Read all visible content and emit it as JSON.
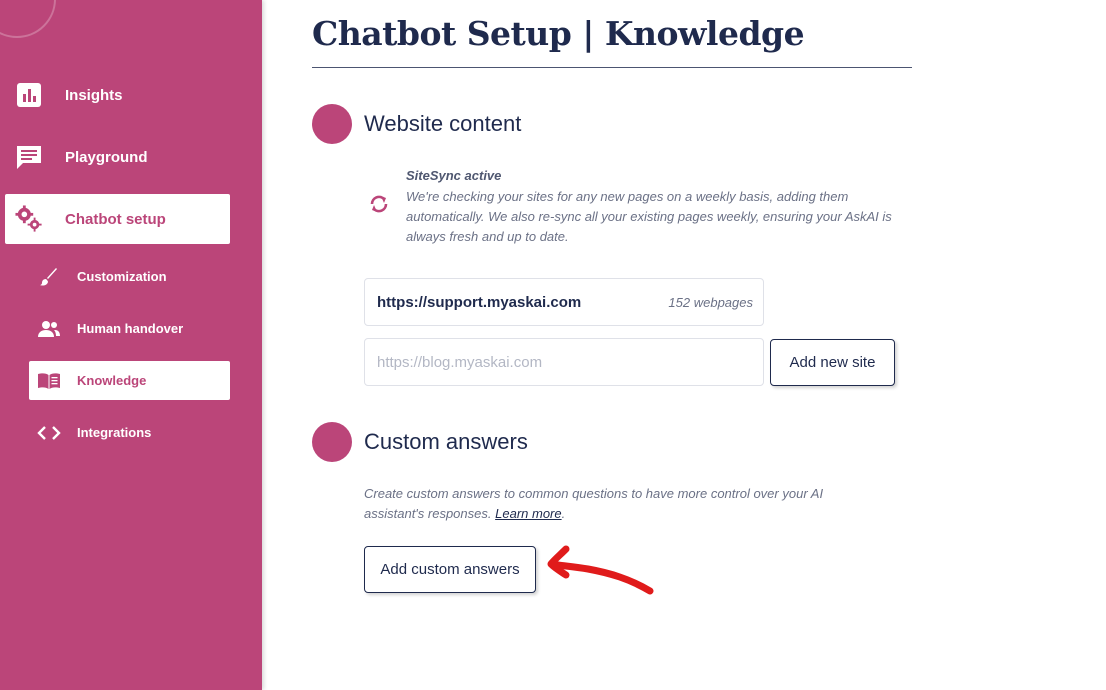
{
  "sidebar": {
    "items": [
      {
        "label": "Insights",
        "icon": "bar-chart-icon"
      },
      {
        "label": "Playground",
        "icon": "chat-icon"
      },
      {
        "label": "Chatbot setup",
        "icon": "gears-icon",
        "active": true
      }
    ],
    "subitems": [
      {
        "label": "Customization",
        "icon": "brush-icon"
      },
      {
        "label": "Human handover",
        "icon": "people-icon"
      },
      {
        "label": "Knowledge",
        "icon": "book-icon",
        "active": true
      },
      {
        "label": "Integrations",
        "icon": "code-icon"
      }
    ]
  },
  "page": {
    "title": "Chatbot Setup | Knowledge"
  },
  "website_content": {
    "title": "Website content",
    "sitesync_title": "SiteSync active",
    "sitesync_desc": "We're checking your sites for any new pages on a weekly basis, adding them automatically. We also re-sync all your existing pages weekly, ensuring your AskAI is always fresh and up to date.",
    "sites": [
      {
        "url": "https://support.myaskai.com",
        "count": "152 webpages"
      }
    ],
    "input_placeholder": "https://blog.myaskai.com",
    "add_button": "Add new site"
  },
  "custom_answers": {
    "title": "Custom answers",
    "desc": "Create custom answers to common questions to have more control over your AI assistant's responses.",
    "learn_more": "Learn more",
    "desc_end": ".",
    "button": "Add custom answers"
  },
  "colors": {
    "brand": "#bb4579",
    "navy": "#1f2a4d",
    "annotation": "#e01b1b"
  }
}
